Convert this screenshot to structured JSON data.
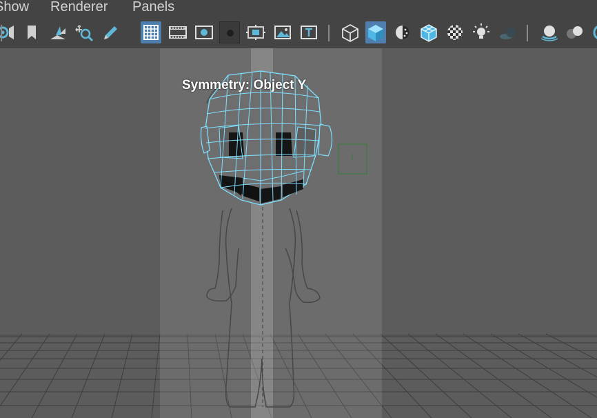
{
  "menu": {
    "items": [
      {
        "label": "Show"
      },
      {
        "label": "Renderer"
      },
      {
        "label": "Panels"
      }
    ]
  },
  "toolbar": {
    "icons": [
      "camera-attributes-icon",
      "bookmark-icon",
      "image-plane-icon",
      "view-transform-icon",
      "pencil-icon",
      "grid-icon",
      "film-gate-icon",
      "resolution-gate-icon",
      "gate-mask-icon",
      "field-chart-icon",
      "safe-action-icon",
      "safe-title-icon",
      "wireframe-icon",
      "smooth-shade-icon",
      "default-lighting-icon",
      "wireframe-on-shaded-icon",
      "textured-icon",
      "use-all-lights-icon",
      "shadows-icon",
      "ambient-occlusion-icon",
      "motion-blur-icon",
      "isolate-select-icon"
    ],
    "active_color": "#4f7fae"
  },
  "viewport": {
    "hud_text": "Symmetry: Object Y",
    "symmetry_color": "#7ec8ff",
    "background_color": "#5c5c5c"
  }
}
